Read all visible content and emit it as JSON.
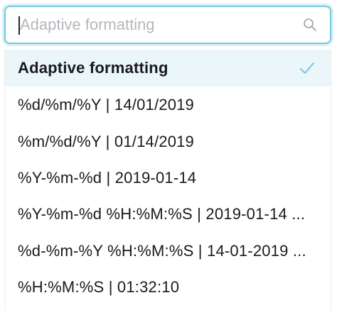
{
  "search": {
    "placeholder": "Adaptive formatting",
    "value": "",
    "icon": "search-icon"
  },
  "dropdown": {
    "selected_index": 0,
    "selected_icon": "check-icon",
    "accent_color": "#78c6de",
    "options": [
      {
        "label": "Adaptive formatting"
      },
      {
        "label": "%d/%m/%Y | 14/01/2019"
      },
      {
        "label": "%m/%d/%Y | 01/14/2019"
      },
      {
        "label": "%Y-%m-%d | 2019-01-14"
      },
      {
        "label": "%Y-%m-%d %H:%M:%S | 2019-01-14 ..."
      },
      {
        "label": "%d-%m-%Y %H:%M:%S | 14-01-2019 ..."
      },
      {
        "label": "%H:%M:%S | 01:32:10"
      }
    ]
  }
}
